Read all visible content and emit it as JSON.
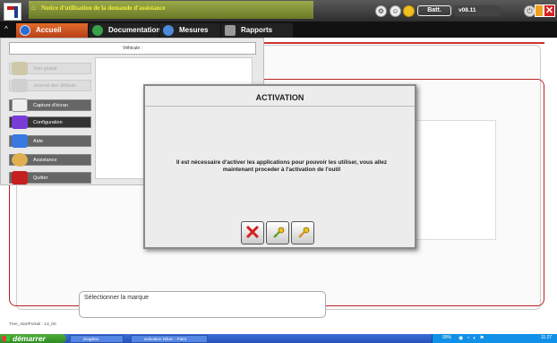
{
  "window": {
    "title": "Notice d'utilisation de la demande d'assistance",
    "battery_label": "Batt.",
    "version": "v08.11",
    "close_glyph": "✕"
  },
  "tabs": [
    {
      "label": "Accueil",
      "icon": "home-globe-icon",
      "color": "#2a6cd6"
    },
    {
      "label": "Documentation",
      "icon": "document-icon",
      "color": "#3aa04a"
    },
    {
      "label": "Mesures",
      "icon": "wave-icon",
      "color": "#4a8ad8"
    },
    {
      "label": "Rapports",
      "icon": "report-icon",
      "color": "#999999"
    }
  ],
  "menu": {
    "vehicle_label": "Véhicule :",
    "items": [
      {
        "label": "Test global",
        "enabled": false
      },
      {
        "label": "Journal des défauts",
        "enabled": false
      },
      {
        "label": "Capture d'écran",
        "enabled": true
      },
      {
        "label": "Configuration",
        "enabled": true
      },
      {
        "label": "Aide",
        "enabled": true
      },
      {
        "label": "Assistance",
        "enabled": true
      },
      {
        "label": "Quitter",
        "enabled": true
      }
    ]
  },
  "dialog": {
    "title": "ACTIVATION",
    "message": "Il est nécessaire d'activer les applications pour pouvoir les utiliser, vous allez maintenant proceder à l'activation de l'outil",
    "buttons": [
      {
        "name": "cancel",
        "icon": "red-cross-icon",
        "glyph": "✕"
      },
      {
        "name": "activate-key",
        "icon": "key-icon"
      },
      {
        "name": "activate-key-2",
        "icon": "key-icon"
      }
    ]
  },
  "main": {
    "marque_label": "Sélectionner la marque",
    "footer_text": "Tree_startPortail : 13_00"
  },
  "taskbar": {
    "start_label": "démarrer",
    "tasks": [
      "DiagBox",
      "activation Diboc - Paint"
    ],
    "battery_pct": "99%",
    "clock": "11:27"
  },
  "colors": {
    "accent": "#e26a2a",
    "frame_red": "#b22222",
    "taskbar_blue": "#2550b8",
    "start_green": "#3a9a2c"
  }
}
